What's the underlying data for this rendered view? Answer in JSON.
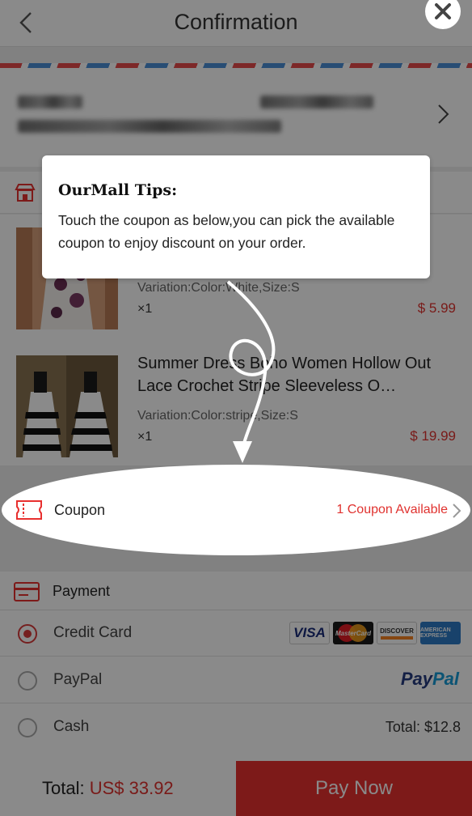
{
  "header": {
    "title": "Confirmation"
  },
  "products": [
    {
      "title": "",
      "variation": "Variation:Color:White,Size:S",
      "qty": "×1",
      "price": "$ 5.99"
    },
    {
      "title": "Summer Dress Boho Women Hollow Out Lace Crochet Stripe Sleeveless O…",
      "variation": "Variation:Color:stripe,Size:S",
      "qty": "×1",
      "price": "$ 19.99"
    }
  ],
  "coupon": {
    "label": "Coupon",
    "available": "1 Coupon Available"
  },
  "payment": {
    "title": "Payment",
    "options": [
      {
        "label": "Credit Card",
        "selected": true
      },
      {
        "label": "PayPal",
        "selected": false
      },
      {
        "label": "Cash",
        "selected": false
      }
    ],
    "cash_total": "Total: $12.8",
    "card_logos": [
      "VISA",
      "MasterCard",
      "DISCOVER",
      "AMERICAN EXPRESS"
    ],
    "paypal_logo": {
      "part1": "Pay",
      "part2": "Pal"
    }
  },
  "footer": {
    "total_label": "Total: ",
    "total_value": "US$ 33.92",
    "pay_now": "Pay Now"
  },
  "tip": {
    "title": "OurMall Tips:",
    "body": "Touch the coupon as below,you can pick the available coupon to enjoy discount on your order."
  },
  "colors": {
    "accent": "#e8302f",
    "price": "#e0322f",
    "overlay": "rgba(0,0,0,0.46)"
  }
}
